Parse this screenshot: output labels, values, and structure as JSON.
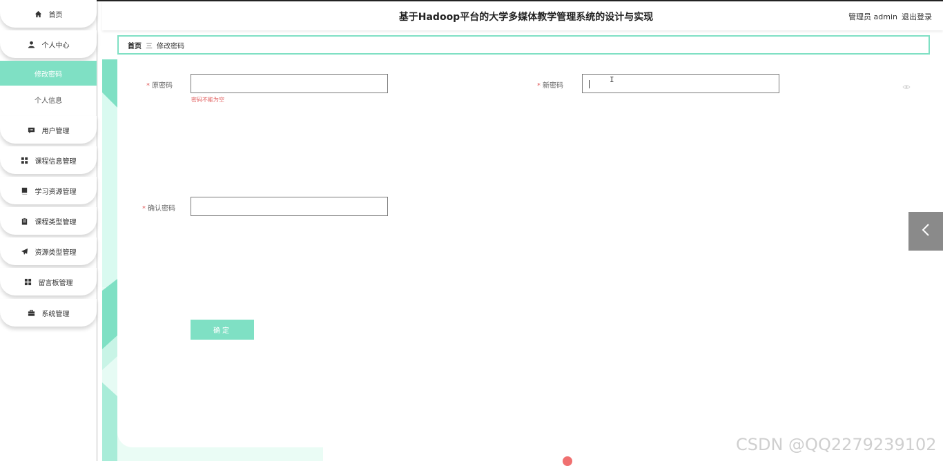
{
  "header": {
    "title": "基于Hadoop平台的大学多媒体教学管理系统的设计与实现",
    "user": "管理员 admin",
    "logout": "退出登录"
  },
  "sidebar": {
    "items": [
      {
        "label": "首页",
        "icon": "home-icon"
      },
      {
        "label": "个人中心",
        "icon": "user-icon"
      },
      {
        "label": "用户管理",
        "icon": "chat-icon"
      },
      {
        "label": "课程信息管理",
        "icon": "grid-icon"
      },
      {
        "label": "学习资源管理",
        "icon": "book-icon"
      },
      {
        "label": "课程类型管理",
        "icon": "clipboard-icon"
      },
      {
        "label": "资源类型管理",
        "icon": "paper-plane-icon"
      },
      {
        "label": "留言板管理",
        "icon": "grid-icon"
      },
      {
        "label": "系统管理",
        "icon": "briefcase-icon"
      }
    ],
    "sub_items": [
      {
        "label": "修改密码",
        "active": true
      },
      {
        "label": "个人信息",
        "active": false
      }
    ]
  },
  "breadcrumb": {
    "home": "首页",
    "separator": "三",
    "current": "修改密码"
  },
  "form": {
    "old_password_label": "原密码",
    "old_password_value": "",
    "old_password_error": "密码不能为空",
    "new_password_label": "新密码",
    "new_password_value": "",
    "confirm_password_label": "确认密码",
    "confirm_password_value": "",
    "required_mark": "*",
    "submit_label": "确定"
  },
  "watermark": "CSDN @QQ2279239102",
  "colors": {
    "accent": "#7fe0c4",
    "error": "#e05a5a",
    "collapse_button": "#8a8a8a"
  }
}
